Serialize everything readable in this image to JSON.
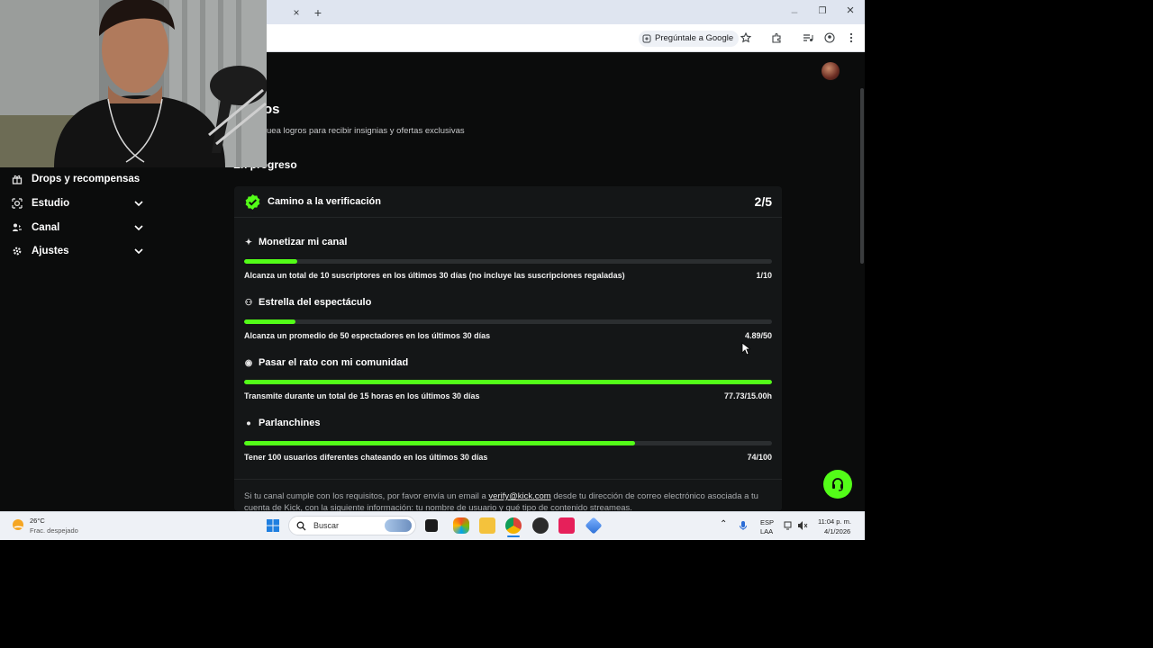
{
  "browser": {
    "tab_close": "×",
    "new_tab": "+",
    "ask_google_label": "Pregúntale a Google",
    "window_controls": {
      "minimize": "‒",
      "restore": "❐",
      "close": "×"
    },
    "icons": [
      "star-icon",
      "extensions-icon",
      "media-icon",
      "profile-icon",
      "kebab-menu-icon"
    ]
  },
  "sidebar": {
    "items": [
      {
        "label": "Drops y recompensas",
        "icon": "gift-icon",
        "expandable": false
      },
      {
        "label": "Estudio",
        "icon": "studio-icon",
        "expandable": true
      },
      {
        "label": "Canal",
        "icon": "channel-icon",
        "expandable": true
      },
      {
        "label": "Ajustes",
        "icon": "gear-icon",
        "expandable": true
      }
    ]
  },
  "main": {
    "title": "os",
    "subtitle": "uea logros para recibir insignias y ofertas exclusivas",
    "section_title": "En progreso",
    "card": {
      "title": "Camino a la verificación",
      "count": "2/5",
      "goals": [
        {
          "title": "Monetizar mi canal",
          "icon": "sparkle-icon",
          "description": "Alcanza un total de 10 suscriptores en los últimos 30 días (no incluye las suscripciones regaladas)",
          "value": "1/10",
          "progress": 0.1
        },
        {
          "title": "Estrella del espectáculo",
          "icon": "viewers-icon",
          "description": "Alcanza un promedio de 50 espectadores en los últimos 30 días",
          "value": "4.89/50",
          "progress": 0.098
        },
        {
          "title": "Pasar el rato con mi comunidad",
          "icon": "broadcast-icon",
          "description": "Transmite durante un total de 15 horas en los últimos 30 días",
          "value": "77.73/15.00h",
          "progress": 1.0
        },
        {
          "title": "Parlanchines",
          "icon": "chat-icon",
          "description": "Tener 100 usuarios diferentes chateando en los últimos 30 días",
          "value": "74/100",
          "progress": 0.74
        }
      ],
      "footer_before": "Si tu canal cumple con los requisitos, por favor envía un email a ",
      "footer_link": "verify@kick.com",
      "footer_after": " desde tu dirección de correo electrónico asociada a tu cuenta de Kick, con la siguiente información: tu nombre de usuario y qué tipo de contenido streameas."
    }
  },
  "taskbar": {
    "weather_temp": "26°C",
    "weather_desc": "Frac. despejado",
    "search_placeholder": "Buscar",
    "lang_line1": "ESP",
    "lang_line2": "LAA",
    "time": "11:04 p. m.",
    "date": "4/1/2026"
  },
  "colors": {
    "accent": "#53fc18",
    "background": "#0b0c0c",
    "card": "#141617"
  }
}
